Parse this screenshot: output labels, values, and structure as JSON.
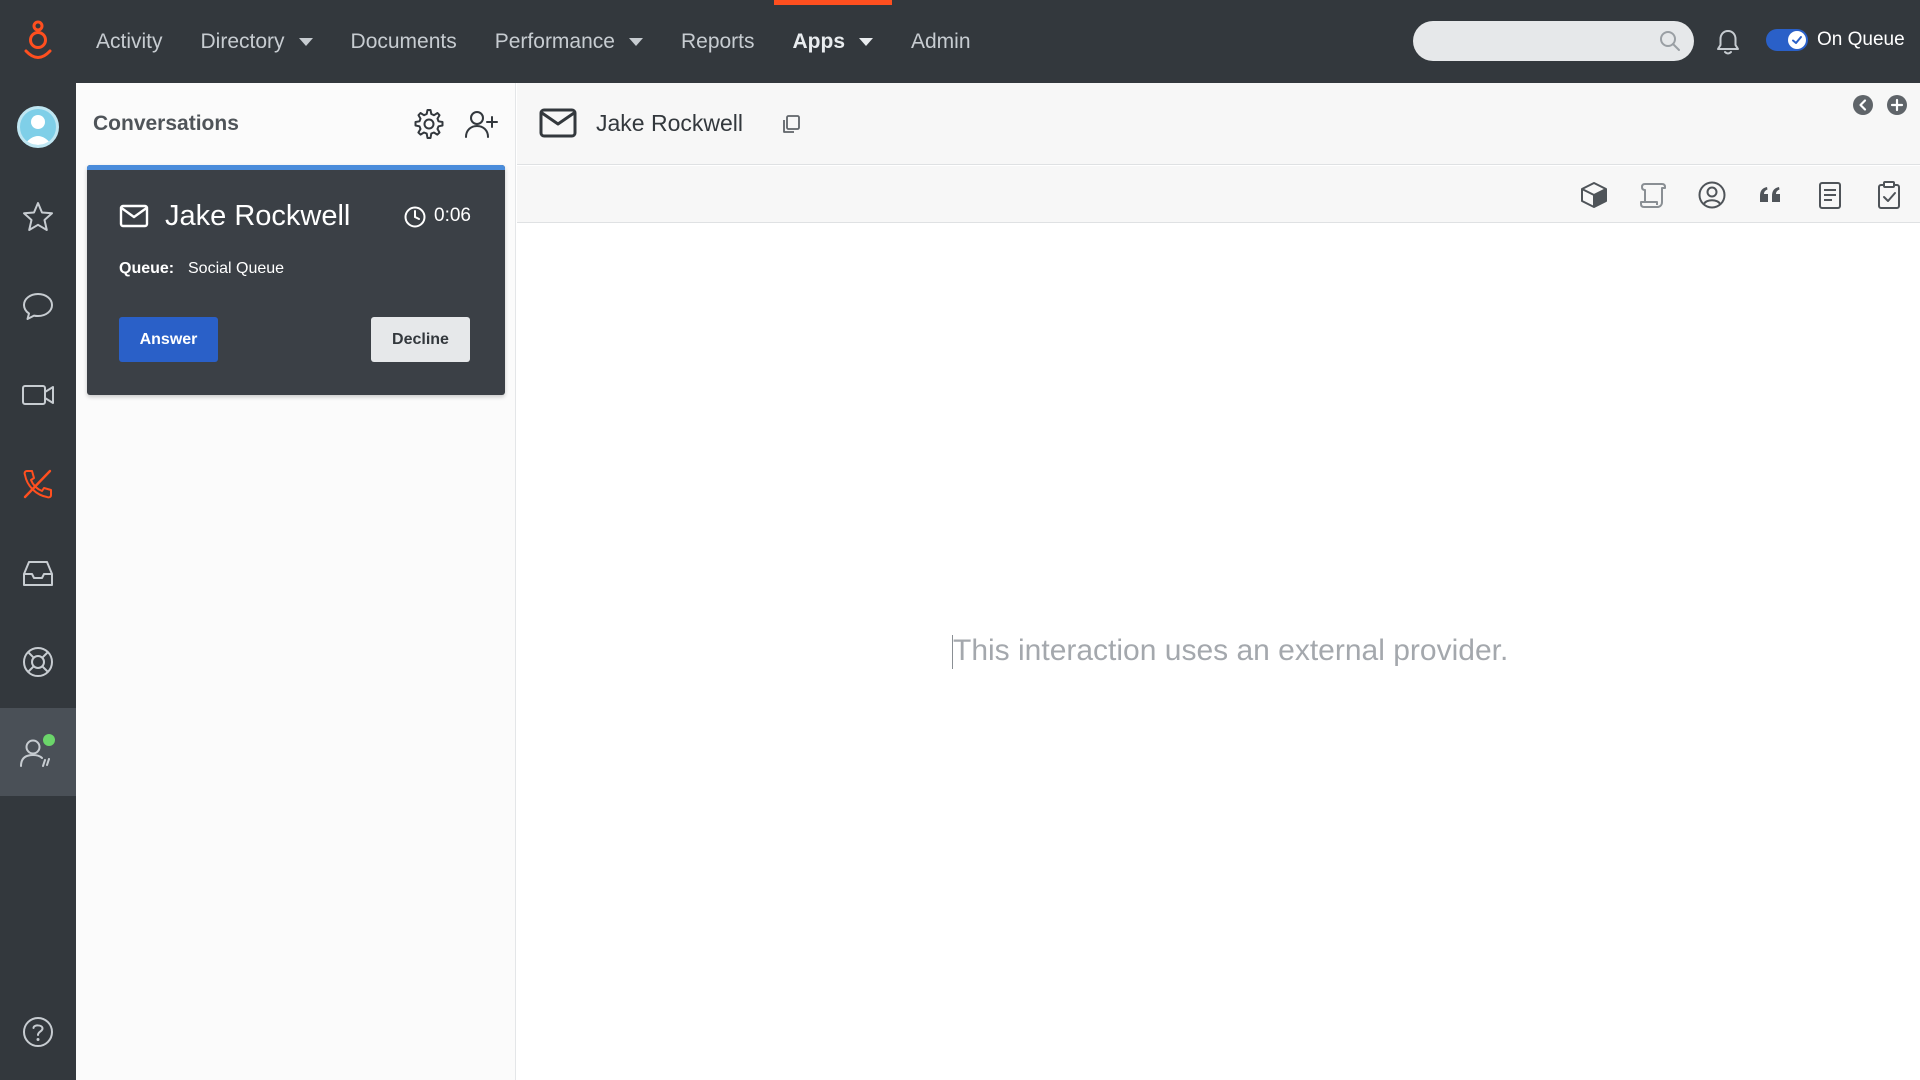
{
  "topbar": {
    "nav": [
      {
        "label": "Activity",
        "dropdown": false,
        "active": false
      },
      {
        "label": "Directory",
        "dropdown": true,
        "active": false
      },
      {
        "label": "Documents",
        "dropdown": false,
        "active": false
      },
      {
        "label": "Performance",
        "dropdown": true,
        "active": false
      },
      {
        "label": "Reports",
        "dropdown": false,
        "active": false
      },
      {
        "label": "Apps",
        "dropdown": true,
        "active": true
      },
      {
        "label": "Admin",
        "dropdown": false,
        "active": false
      }
    ],
    "search_value": "",
    "status_label": "On Queue",
    "status_on": true
  },
  "rail": {
    "items": [
      "avatar",
      "star-icon",
      "chat-icon",
      "video-icon",
      "phone-off-icon",
      "inbox-icon",
      "lifebuoy-icon",
      "agent-status-icon",
      "help-icon"
    ],
    "active_item": "agent-status-icon"
  },
  "conversations": {
    "title": "Conversations",
    "card": {
      "name": "Jake Rockwell",
      "time": "0:06",
      "queue_label": "Queue:",
      "queue_value": "Social Queue",
      "answer_label": "Answer",
      "decline_label": "Decline"
    }
  },
  "main": {
    "contact_name": "Jake Rockwell",
    "toolbar_icons": [
      "cube-icon",
      "script-icon",
      "user-circle-icon",
      "quote-icon",
      "document-icon",
      "clipboard-check-icon"
    ],
    "message": "This interaction uses an external provider."
  },
  "colors": {
    "topbar_bg": "#33383d",
    "active_nav_accent": "#ff4f1f",
    "brand_orange": "#ff4f1f",
    "primary_button": "#2a60c8",
    "card_bg": "#3b4046",
    "card_progress": "#4a8cdb",
    "presence_green": "#6bd56a"
  }
}
